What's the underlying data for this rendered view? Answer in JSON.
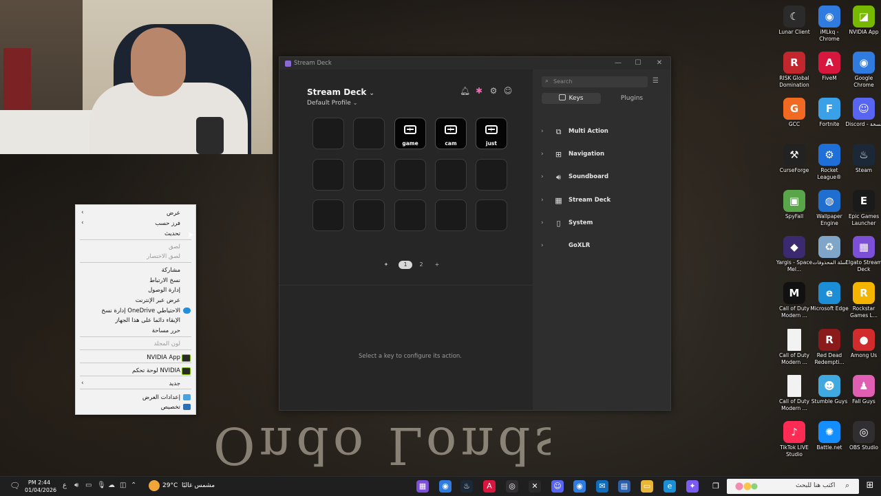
{
  "wallpaper": {
    "art_text": "Ondo Londs"
  },
  "context_menu": {
    "items": [
      {
        "label": "عرض",
        "submenu": true
      },
      {
        "label": "فرز حسب",
        "submenu": true
      },
      {
        "label": "تحديث"
      },
      {
        "label": "لصق",
        "disabled": true
      },
      {
        "label": "لصق الاختصار",
        "disabled": true
      },
      {
        "label": "مشاركة"
      },
      {
        "label": "نسخ الارتباط"
      },
      {
        "label": "إدارة الوصول"
      },
      {
        "label": "عرض عبر الإنترنت"
      },
      {
        "label": "إدارة نسخ OneDrive الاحتياطي",
        "icon": "onedrive-icon"
      },
      {
        "label": "الإبقاء دائما على هذا الجهاز"
      },
      {
        "label": "حرر مساحة"
      },
      {
        "label": "لون المجلد",
        "disabled": true
      },
      {
        "label": "NVIDIA App",
        "icon": "nvidia-icon"
      },
      {
        "label": "لوحة تحكم NVIDIA",
        "icon": "nvidia-icon"
      },
      {
        "label": "جديد",
        "submenu": true
      },
      {
        "label": "إعدادات العرض",
        "icon": "display-icon"
      },
      {
        "label": "تخصيص",
        "icon": "personalize-icon"
      }
    ]
  },
  "stream_deck": {
    "window_title": "Stream Deck",
    "device_name": "Stream Deck",
    "profile": "Default Profile",
    "keys": [
      {
        "label": ""
      },
      {
        "label": ""
      },
      {
        "label": "game"
      },
      {
        "label": "cam"
      },
      {
        "label": "just"
      },
      {
        "label": ""
      },
      {
        "label": ""
      },
      {
        "label": ""
      },
      {
        "label": ""
      },
      {
        "label": ""
      },
      {
        "label": ""
      },
      {
        "label": ""
      },
      {
        "label": ""
      },
      {
        "label": ""
      },
      {
        "label": ""
      }
    ],
    "pages": [
      "1",
      "2"
    ],
    "active_page": "1",
    "hint": "Select a key to configure its action.",
    "search_placeholder": "Search",
    "tabs": [
      "Keys",
      "Plugins"
    ],
    "active_tab": "Keys",
    "categories": [
      "Multi Action",
      "Navigation",
      "Soundboard",
      "Stream Deck",
      "System",
      "GoXLR"
    ]
  },
  "desktop_icons": [
    {
      "label": "Lunar Client",
      "icon": "lunar-client-icon",
      "color": "#2b2b2b",
      "glyph": "☾"
    },
    {
      "label": "iMLkq - Chrome",
      "icon": "chrome-icon",
      "color": "#2f7be0",
      "glyph": "◉"
    },
    {
      "label": "NVIDIA App",
      "icon": "nvidia-icon",
      "color": "#76b900",
      "glyph": "◪"
    },
    {
      "label": "RISK Global Domination",
      "icon": "risk-icon",
      "color": "#c1272d",
      "glyph": "R"
    },
    {
      "label": "FiveM",
      "icon": "fivem-icon",
      "color": "#d8173f",
      "glyph": "A"
    },
    {
      "label": "Google Chrome",
      "icon": "chrome-icon",
      "color": "#2f7be0",
      "glyph": "◉"
    },
    {
      "label": "GCC",
      "icon": "gcc-icon",
      "color": "#f26a21",
      "glyph": "G"
    },
    {
      "label": "Fortnite",
      "icon": "fortnite-icon",
      "color": "#3aa0e8",
      "glyph": "F"
    },
    {
      "label": "Discord - نسخة",
      "icon": "discord-icon",
      "color": "#5865f2",
      "glyph": "☺"
    },
    {
      "label": "CurseForge",
      "icon": "curseforge-icon",
      "color": "#222222",
      "glyph": "⚒"
    },
    {
      "label": "Rocket League®",
      "icon": "rocket-league-icon",
      "color": "#1e6fd8",
      "glyph": "⚙"
    },
    {
      "label": "Steam",
      "icon": "steam-icon",
      "color": "#1b2838",
      "glyph": "♨"
    },
    {
      "label": "SpyFall",
      "icon": "spyfall-icon",
      "color": "#59a54a",
      "glyph": "▣"
    },
    {
      "label": "Wallpaper Engine",
      "icon": "wallpaper-engine-icon",
      "color": "#1f6fd1",
      "glyph": "◍"
    },
    {
      "label": "Epic Games Launcher",
      "icon": "epic-games-icon",
      "color": "#1a1a1a",
      "glyph": "E"
    },
    {
      "label": "Yargis - Space Mel...",
      "icon": "yargis-icon",
      "color": "#3b2a70",
      "glyph": "◆"
    },
    {
      "label": "سلة المحذوفات",
      "icon": "recycle-bin-icon",
      "color": "#7fa6c8",
      "glyph": "♻"
    },
    {
      "label": "Elgato Stream Deck",
      "icon": "stream-deck-icon",
      "color": "#7b4fd6",
      "glyph": "▦"
    },
    {
      "label": "Call of Duty Modern ...",
      "icon": "call-of-duty-icon",
      "color": "#111111",
      "glyph": "M"
    },
    {
      "label": "Microsoft Edge",
      "icon": "edge-icon",
      "color": "#1c8ed6",
      "glyph": "e"
    },
    {
      "label": "Rockstar Games L...",
      "icon": "rockstar-icon",
      "color": "#f4b400",
      "glyph": "R"
    },
    {
      "label": "Call of Duty Modern ...",
      "icon": "file-icon",
      "color": "#f2f2f2",
      "glyph": ""
    },
    {
      "label": "Red Dead Redempti...",
      "icon": "red-dead-icon",
      "color": "#8b1a1a",
      "glyph": "R"
    },
    {
      "label": "Among Us",
      "icon": "among-us-icon",
      "color": "#d12b2b",
      "glyph": "●"
    },
    {
      "label": "Call of Duty Modern ...",
      "icon": "file-icon",
      "color": "#f2f2f2",
      "glyph": ""
    },
    {
      "label": "Stumble Guys",
      "icon": "stumble-guys-icon",
      "color": "#3fa9e0",
      "glyph": "☻"
    },
    {
      "label": "Fall Guys",
      "icon": "fall-guys-icon",
      "color": "#e05fb3",
      "glyph": "♟"
    },
    {
      "label": "TikTok LIVE Studio",
      "icon": "tiktok-icon",
      "color": "#fe2c55",
      "glyph": "♪"
    },
    {
      "label": "Battle.net",
      "icon": "battlenet-icon",
      "color": "#148eff",
      "glyph": "✺"
    },
    {
      "label": "OBS Studio",
      "icon": "obs-icon",
      "color": "#302e31",
      "glyph": "◎"
    }
  ],
  "taskbar": {
    "search_placeholder": "اكتب هنا للبحث",
    "time": "PM 2:44",
    "date": "01/04/2026",
    "weather_temp": "29°C",
    "weather_text": "مشمس غالبًا",
    "language": "ع",
    "apps": [
      {
        "icon": "stream-deck-icon",
        "color": "#7b4fd6",
        "glyph": "▦"
      },
      {
        "icon": "chrome-icon",
        "color": "#2f7be0",
        "glyph": "◉"
      },
      {
        "icon": "steam-icon",
        "color": "#1b2838",
        "glyph": "♨"
      },
      {
        "icon": "fivem-icon",
        "color": "#d8173f",
        "glyph": "A"
      },
      {
        "icon": "obs-icon",
        "color": "#302e31",
        "glyph": "◎"
      },
      {
        "icon": "xbox-icon",
        "color": "#2a2a2a",
        "glyph": "✕"
      },
      {
        "icon": "discord-icon",
        "color": "#5865f2",
        "glyph": "☺"
      },
      {
        "icon": "chrome-icon",
        "color": "#2f7be0",
        "glyph": "◉"
      },
      {
        "icon": "outlook-icon",
        "color": "#0f6cbd",
        "glyph": "✉"
      },
      {
        "icon": "store-icon",
        "color": "#2a5ea8",
        "glyph": "▤"
      },
      {
        "icon": "file-explorer-icon",
        "color": "#e8b73a",
        "glyph": "▭"
      },
      {
        "icon": "edge-icon",
        "color": "#1c8ed6",
        "glyph": "e"
      },
      {
        "icon": "copilot-icon",
        "color": "#7b5cf0",
        "glyph": "✦"
      },
      {
        "icon": "task-view-icon",
        "color": "#1f1f1f",
        "glyph": "❐"
      }
    ]
  }
}
